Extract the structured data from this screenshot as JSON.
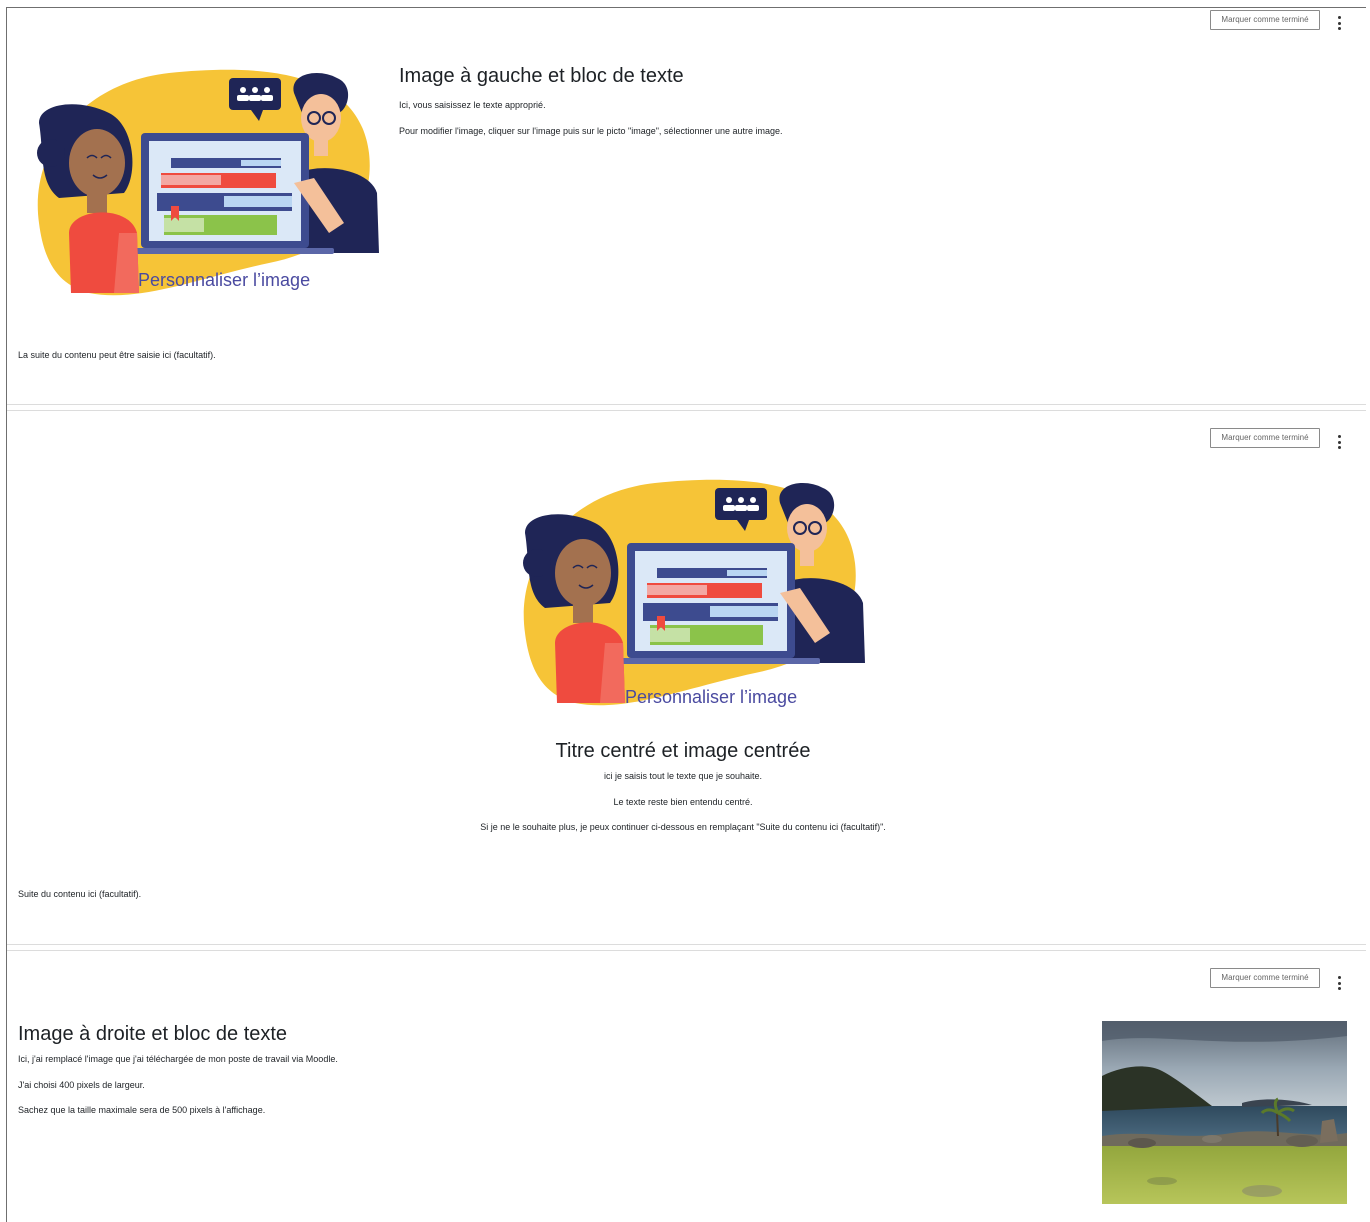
{
  "sections": [
    {
      "mark_label": "Marquer comme terminé",
      "title": "Image à gauche et bloc de texte",
      "paragraphs": [
        "Ici, vous saisissez le texte approprié.",
        "Pour modifier l'image, cliquer sur l'image puis sur le picto \"image\", sélectionner une autre image."
      ],
      "image_caption": "Personnaliser l’image",
      "footer_text": "La suite du contenu peut être saisie ici (facultatif)."
    },
    {
      "mark_label": "Marquer comme terminé",
      "title": "Titre centré et image centrée",
      "paragraphs": [
        "ici je saisis tout le texte que je souhaite.",
        "Le texte reste bien entendu centré.",
        "Si je ne le souhaite plus, je peux continuer ci-dessous en remplaçant \"Suite du contenu ici (facultatif)\"."
      ],
      "image_caption": "Personnaliser l’image",
      "footer_text": "Suite du contenu ici (facultatif)."
    },
    {
      "mark_label": "Marquer comme terminé",
      "title": "Image à droite et bloc de texte",
      "paragraphs": [
        "Ici, j'ai remplacé l'image que j'ai téléchargée de mon poste de travail via Moodle.",
        "J'ai choisi 400 pixels de largeur.",
        "Sachez que la taille maximale sera de 500 pixels à l'affichage."
      ]
    }
  ],
  "colors": {
    "caption": "#4a4aa0",
    "blob": "#f6c437",
    "navy": "#1f2556",
    "accent": "#ef4b3f"
  }
}
